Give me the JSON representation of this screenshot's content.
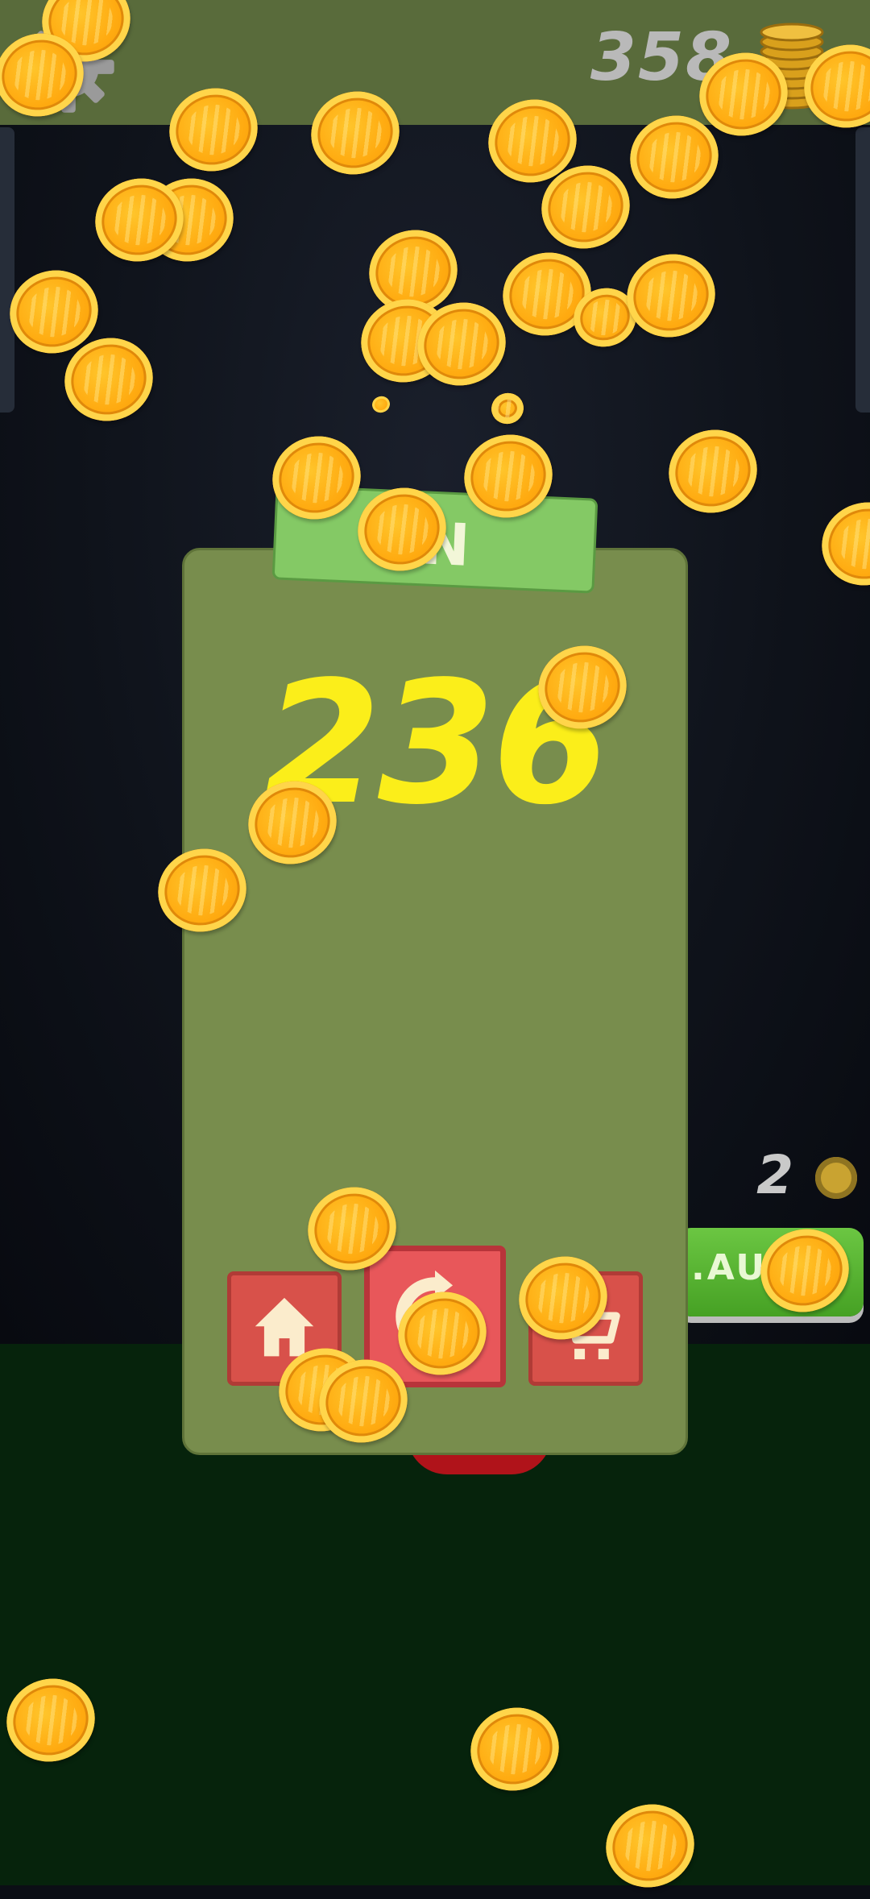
{
  "top_bar": {
    "settings_icon": "gear-icon",
    "coin_count": "358",
    "coin_icon": "coin-stack-icon"
  },
  "side": {
    "counter": "2",
    "counter_icon": "coin-icon",
    "auto_button_label": ".AU"
  },
  "result": {
    "ribbon_label": "IN",
    "amount": "236"
  },
  "buttons": {
    "home_icon": "home-icon",
    "replay_icon": "replay-icon",
    "shop_icon": "cart-icon"
  },
  "colors": {
    "top_bar": "#596b3b",
    "panel": "#788d4d",
    "ribbon": "#84c965",
    "amount": "#fbee1a",
    "button_red": "#d8514a",
    "floor": "#06230c",
    "coin": "#ffaa10"
  }
}
